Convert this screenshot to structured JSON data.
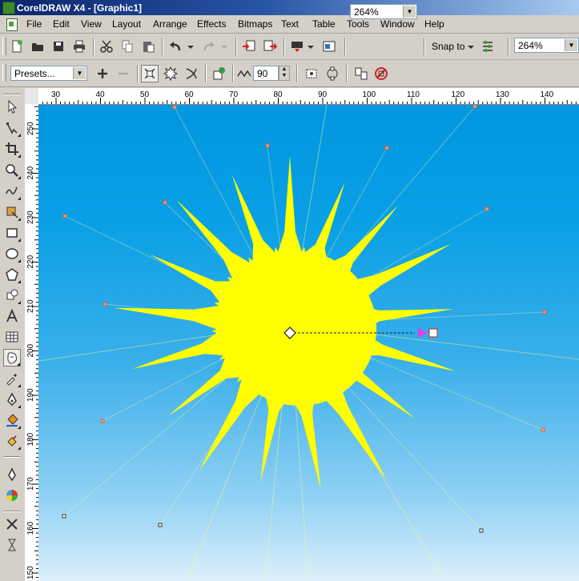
{
  "window": {
    "title": "CorelDRAW X4 - [Graphic1]"
  },
  "menu": [
    "File",
    "Edit",
    "View",
    "Layout",
    "Arrange",
    "Effects",
    "Bitmaps",
    "Text",
    "Table",
    "Tools",
    "Window",
    "Help"
  ],
  "standard_toolbar": {
    "zoom_level": "264%",
    "snap_to_label": "Snap to",
    "zoom_level_2": "264%"
  },
  "property_bar": {
    "presets_value": "Presets...",
    "angle_value": "90"
  },
  "ruler": {
    "horizontal_ticks": [
      "30",
      "40",
      "50",
      "60",
      "70",
      "80",
      "90",
      "100",
      "110",
      "120",
      "130",
      "140"
    ],
    "vertical_ticks": [
      "250",
      "240",
      "230",
      "220",
      "210",
      "200",
      "190",
      "180",
      "170",
      "160",
      "150"
    ]
  },
  "toolbox_tools": [
    "pick-tool",
    "shape-tool",
    "crop-tool",
    "zoom-tool",
    "freehand-tool",
    "smart-fill-tool",
    "rectangle-tool",
    "ellipse-tool",
    "polygon-tool",
    "basic-shapes-tool",
    "text-tool",
    "table-tool",
    "interactive-distort-tool",
    "eyedropper-tool",
    "outline-tool",
    "fill-tool",
    "interactive-fill-tool",
    "pen-tool",
    "color-palette-tool",
    "close-tool",
    "hourglass-tool"
  ],
  "colors": {
    "sun_fill": "#ffff00",
    "background_top": "#0097e0",
    "background_bottom": "#dcf0fb",
    "handle_color": "#cc6644",
    "vector_arrow": "#e040e0"
  }
}
